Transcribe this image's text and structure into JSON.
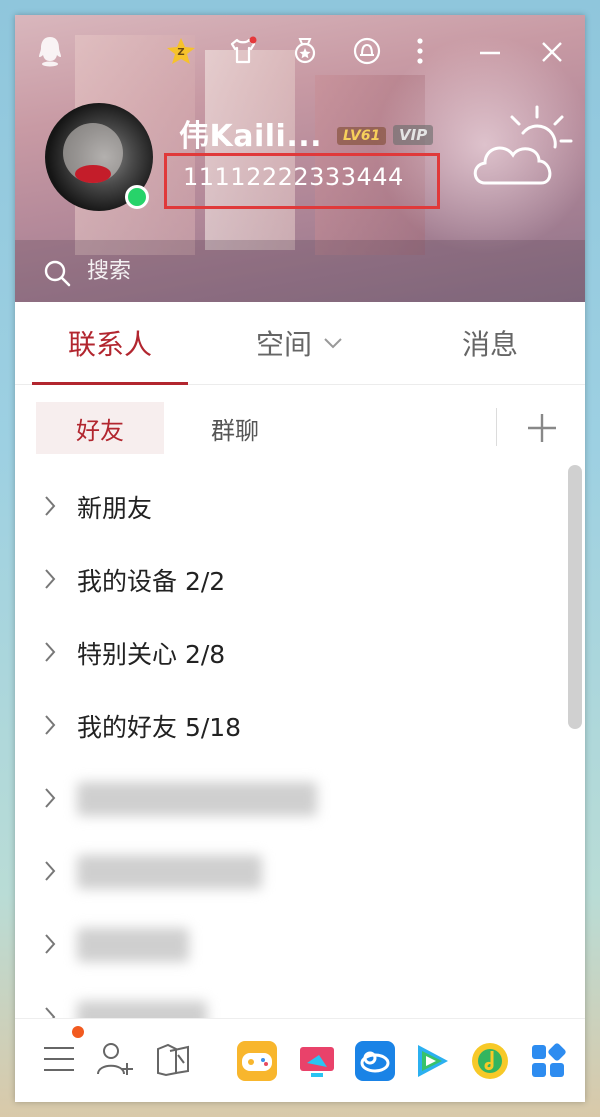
{
  "header": {
    "nickname": "伟Kaili...",
    "level_badge": "LV61",
    "vip_badge": "VIP",
    "account_id": "11112222333444",
    "status": "online",
    "weather_icon": "cloudy-sun-icon",
    "top_icons": [
      "qq-ghost-icon",
      "super-member-star-icon",
      "outfit-shirt-icon",
      "medal-icon",
      "qzone-bell-icon",
      "more-vertical-icon",
      "minimize-icon",
      "close-icon"
    ]
  },
  "search": {
    "placeholder": "搜索"
  },
  "main_tabs": [
    {
      "label": "联系人",
      "active": true
    },
    {
      "label": "空间",
      "has_dropdown": true
    },
    {
      "label": "消息"
    }
  ],
  "sub_tabs": [
    {
      "label": "好友",
      "active": true
    },
    {
      "label": "群聊"
    }
  ],
  "groups": [
    {
      "label": "新朋友"
    },
    {
      "label": "我的设备 2/2"
    },
    {
      "label": "特别关心 2/8"
    },
    {
      "label": "我的好友 5/18"
    }
  ],
  "bottom_bar": {
    "left_icons": [
      "menu-icon",
      "add-friend-icon",
      "files-icon"
    ],
    "app_icons": [
      "game-center-icon",
      "tencent-classroom-icon",
      "weiyun-icon",
      "tencent-video-icon",
      "qq-music-icon",
      "app-store-icon"
    ]
  },
  "colors": {
    "accent": "#b2262f",
    "online": "#27d36a",
    "highlight_box": "#e0393a"
  }
}
